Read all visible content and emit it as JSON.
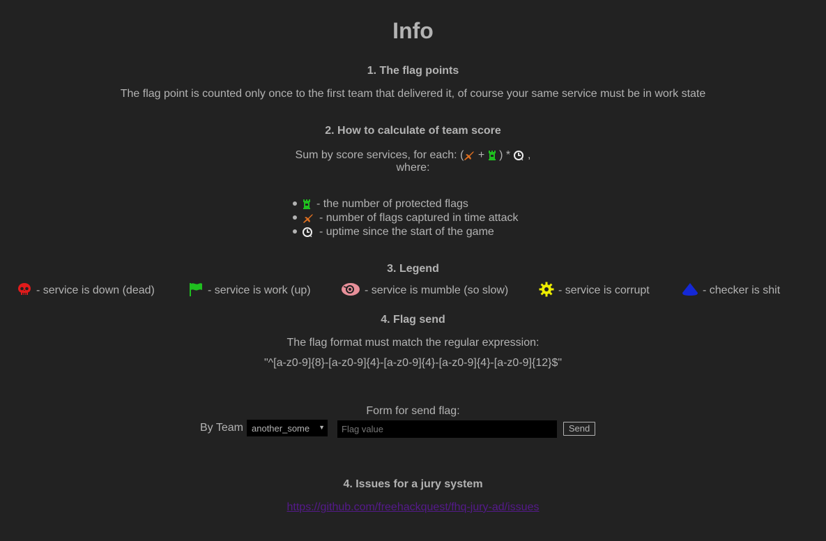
{
  "page": {
    "title": "Info"
  },
  "flag_points": {
    "heading": "1. The flag points",
    "text": "The flag point is counted only once to the first team that delivered it, of course your same service must be in work state"
  },
  "team_score": {
    "heading": "2. How to calculate of team score",
    "formula_prefix": "Sum by score services, for each: (",
    "formula_plus": "+",
    "formula_close": ") *",
    "formula_comma": ",",
    "formula_where": "where:",
    "definitions": [
      {
        "icon": "tower-icon",
        "text": "- the number of protected flags"
      },
      {
        "icon": "jet-icon",
        "text": "- number of flags captured in time attack"
      },
      {
        "icon": "uptime-clock-icon",
        "text": "- uptime since the start of the game"
      }
    ]
  },
  "legend": {
    "heading": "3. Legend",
    "items": [
      {
        "icon": "skull-icon",
        "text": "- service is down (dead)",
        "color": "#e01b1b"
      },
      {
        "icon": "flag-icon",
        "text": "- service is work (up)",
        "color": "#1fbf1f"
      },
      {
        "icon": "snail-icon",
        "text": "- service is mumble (so slow)",
        "color": "#e8909a"
      },
      {
        "icon": "gear-icon",
        "text": "- service is corrupt",
        "color": "#ecec00"
      },
      {
        "icon": "triangle-icon",
        "text": "- checker is shit",
        "color": "#1428d6"
      }
    ]
  },
  "flag_send": {
    "heading": "4. Flag send",
    "format_text": "The flag format must match the regular expression:",
    "regex": "\"^[a-z0-9]{8}-[a-z0-9]{4}-[a-z0-9]{4}-[a-z0-9]{4}-[a-z0-9]{12}$\"",
    "form_label": "Form for send flag:",
    "by_team_label": "By Team",
    "selected_team": "another_some",
    "flag_placeholder": "Flag value",
    "send_label": "Send"
  },
  "issues": {
    "heading": "4. Issues for a jury system",
    "link_text": "https://github.com/freehackquest/fhq-jury-ad/issues"
  },
  "colors": {
    "background": "#222222",
    "text": "#b3b3b3",
    "jet": "#e07020",
    "tower": "#1fbf1f",
    "link": "#551a8b"
  }
}
